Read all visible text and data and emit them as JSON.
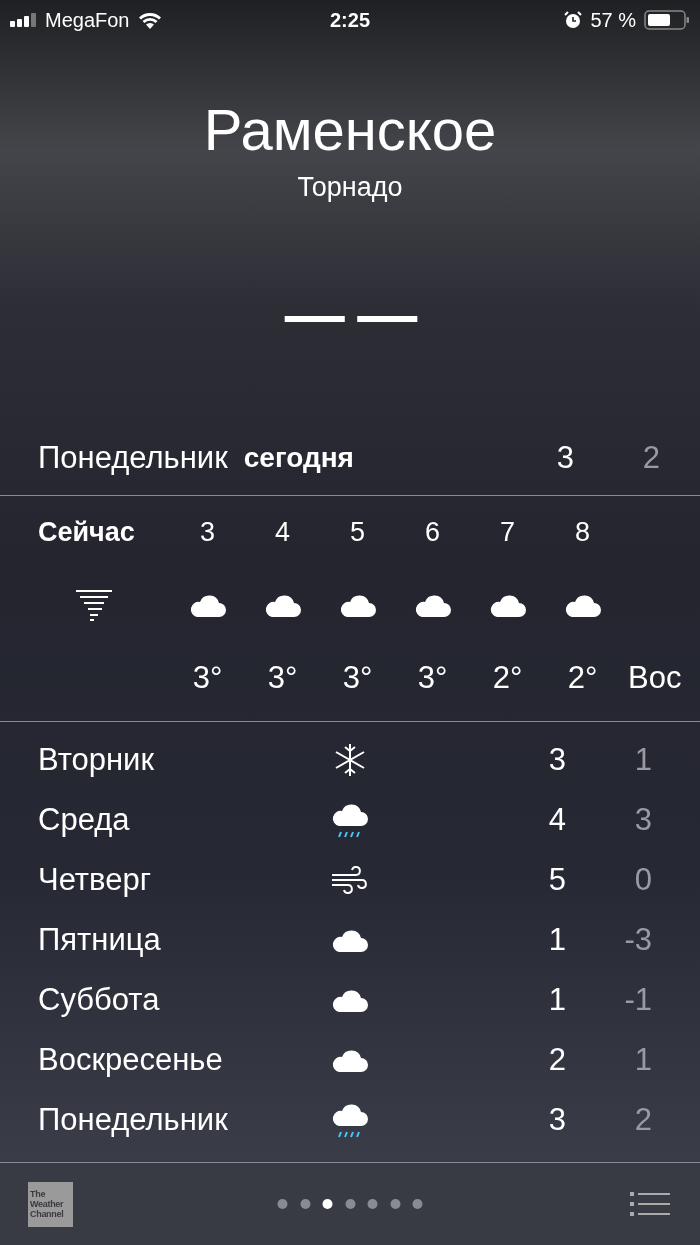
{
  "status_bar": {
    "carrier": "MegaFon",
    "time": "2:25",
    "battery": "57 %"
  },
  "location": {
    "city": "Раменское",
    "condition": "Торнадо",
    "temperature": "— —"
  },
  "today": {
    "day": "Понедельник",
    "label": "сегодня",
    "high": "3",
    "low": "2"
  },
  "hourly": [
    {
      "time": "Сейчас",
      "kind": "tornado",
      "now": true
    },
    {
      "time": "3",
      "kind": "cloud",
      "temp": "3°",
      "now": false
    },
    {
      "time": "4",
      "kind": "cloud",
      "temp": "3°",
      "now": false
    },
    {
      "time": "5",
      "kind": "cloud",
      "temp": "3°",
      "now": false
    },
    {
      "time": "6",
      "kind": "cloud",
      "temp": "3°",
      "now": false
    },
    {
      "time": "7",
      "kind": "cloud",
      "temp": "2°",
      "now": false
    },
    {
      "time": "8",
      "kind": "cloud",
      "temp": "2°",
      "now": false
    },
    {
      "temp": "Вос",
      "now": false
    }
  ],
  "daily": [
    {
      "day": "Вторник",
      "kind": "snow",
      "high": "3",
      "low": "1"
    },
    {
      "day": "Среда",
      "kind": "rain",
      "high": "4",
      "low": "3"
    },
    {
      "day": "Четверг",
      "kind": "wind",
      "high": "5",
      "low": "0"
    },
    {
      "day": "Пятница",
      "kind": "cloud",
      "high": "1",
      "low": "-3"
    },
    {
      "day": "Суббота",
      "kind": "cloud",
      "high": "1",
      "low": "-1"
    },
    {
      "day": "Воскресенье",
      "kind": "cloud",
      "high": "2",
      "low": "1"
    },
    {
      "day": "Понедельник",
      "kind": "rain",
      "high": "3",
      "low": "2"
    }
  ],
  "footer": {
    "logo_lines": [
      "The",
      "Weather",
      "Channel"
    ],
    "pages": [
      {
        "selected": false
      },
      {
        "selected": false
      },
      {
        "selected": true
      },
      {
        "selected": false
      },
      {
        "selected": false
      },
      {
        "selected": false
      },
      {
        "selected": false
      }
    ]
  }
}
